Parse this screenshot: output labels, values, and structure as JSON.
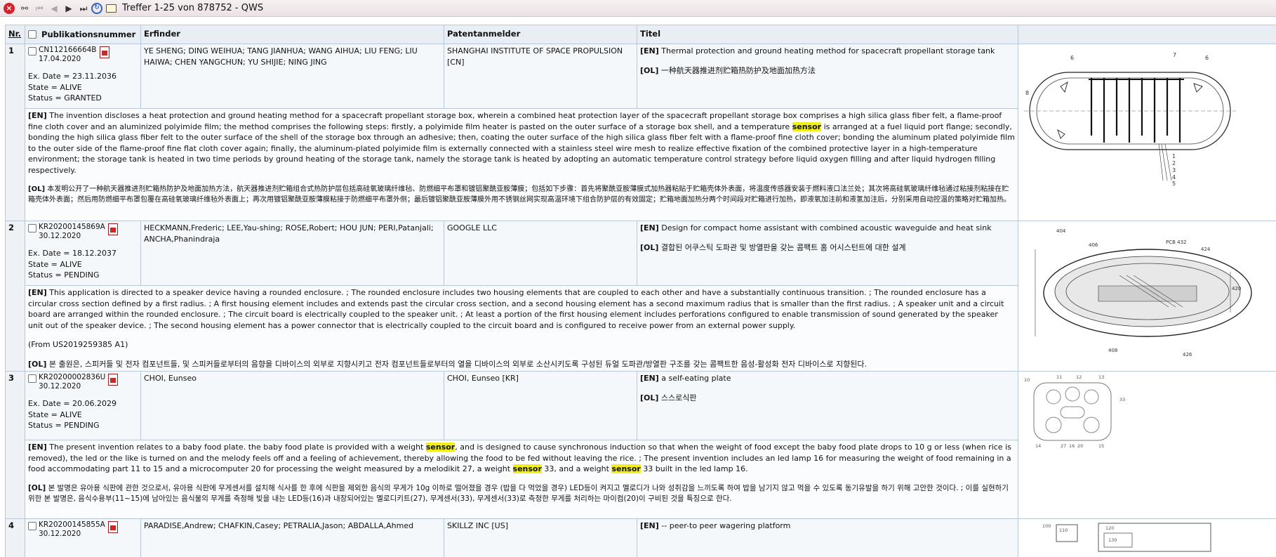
{
  "window": {
    "title": "Treffer 1-25 von 878752 - QWS"
  },
  "columns": {
    "nr": "Nr.",
    "publication": "Publikationsnummer",
    "inventor": "Erfinder",
    "applicant": "Patentanmelder",
    "title": "Titel"
  },
  "rows": [
    {
      "nr": "1",
      "pub_number": "CN112166664B",
      "pub_date": "17.04.2020",
      "ex_date": "Ex. Date = 23.11.2036",
      "state": "State = ALIVE",
      "status": "Status = GRANTED",
      "inventors": "YE SHENG; DING WEIHUA; TANG JIANHUA; WANG AIHUA; LIU FENG; LIU HAIWA; CHEN YANGCHUN; YU SHIJIE; NING JING",
      "applicant": "SHANGHAI INSTITUTE OF SPACE PROPULSION [CN]",
      "title_en_tag": "[EN]",
      "title_en": "Thermal protection and ground heating method for spacecraft propellant storage tank",
      "title_ol_tag": "[OL]",
      "title_ol": "一种航天器推进剂贮箱热防护及地面加热方法",
      "abstract_en_tag": "[EN]",
      "abstract_en_a": "The invention discloses a heat protection and ground heating method for a spacecraft propellant storage box, wherein a combined heat protection layer of the spacecraft propellant storage box comprises a high silica glass fiber felt, a flame-proof fine cloth cover and an aluminized polyimide film; the method comprises the following steps: firstly, a polyimide film heater is pasted on the outer surface of a storage box shell, and a temperature",
      "abstract_en_hl1": "sensor",
      "abstract_en_b": "is arranged at a fuel liquid port flange; secondly, bonding the high silica glass fiber felt to the outer surface of the shell of the storage box through an adhesive; then, coating the outer surface of the high silica glass fiber felt with a flame-proof fine cloth cover; bonding the aluminum plated polyimide film to the outer side of the flame-proof fine flat cloth cover again; finally, the aluminum-plated polyimide film is externally connected with a stainless steel wire mesh to realize effective fixation of the combined protective layer in a high-temperature environment; the storage tank is heated in two time periods by ground heating of the storage tank, namely the storage tank is heated by adopting an automatic temperature control strategy before liquid oxygen filling and after liquid hydrogen filling respectively.",
      "abstract_ol_tag": "[OL]",
      "abstract_ol": "本发明公开了一种航天器推进剂贮箱热防护及地面加热方法，航天器推进剂贮箱组合式热防护层包括高硅氧玻璃纤维毡、防燃细平布罩和镀铝聚酰亚胺薄膜；包括如下步骤：首先将聚酰亚胺薄膜式加热器粘贴于贮箱壳体外表面，将温度传感器安装于燃料液口法兰处；其次将高硅氧玻璃纤维毡通过粘接剂粘接在贮箱壳体外表面；然后用防燃细平布罩包覆在高硅氧玻璃纤维毡外表面上；再次用镀铝聚酰亚胺薄膜粘接于防燃细平布罩外侧；最后镀铝聚酰亚胺薄膜外用不锈钢丝网实现高温环境下组合防护层的有效固定；贮箱地面加热分两个时间段对贮箱进行加热，即液氧加注前和液氢加注后，分别采用自动控温的策略对贮箱加热。"
    },
    {
      "nr": "2",
      "pub_number": "KR20200145869A",
      "pub_date": "30.12.2020",
      "ex_date": "Ex. Date = 18.12.2037",
      "state": "State = ALIVE",
      "status": "Status = PENDING",
      "inventors": "HECKMANN,Frederic; LEE,Yau-shing; ROSE,Robert; HOU JUN; PERI,Patanjali; ANCHA,Phanindraja",
      "applicant": "GOOGLE LLC",
      "title_en_tag": "[EN]",
      "title_en": "Design for compact home assistant with combined acoustic waveguide and heat sink",
      "title_ol_tag": "[OL]",
      "title_ol": "결합된 어쿠스틱 도파관 및 방열판을 갖는 콤팩트 홈 어시스턴트에 대한 설계",
      "abstract_en_tag": "[EN]",
      "abstract_en": "This application is directed to a speaker device having a rounded enclosure. ; The rounded enclosure includes two housing elements that are coupled to each other and have a substantially continuous transition. ; The rounded enclosure has a circular cross section defined by a first radius. ; A first housing element includes and extends past the circular cross section, and a second housing element has a second maximum radius that is smaller than the first radius. ; A speaker unit and a circuit board are arranged within the rounded enclosure. ; The circuit board is electrically coupled to the speaker unit. ; At least a portion of the first housing element includes perforations configured to enable transmission of sound generated by the speaker unit out of the speaker device. ; The second housing element has a power connector that is electrically coupled to the circuit board and is configured to receive power from an external power supply.",
      "abstract_from": "(From US2019259385 A1)",
      "abstract_ol_tag": "[OL]",
      "abstract_ol": "본 출원은, 스피커들 및 전자 컴포넌트들, 및 스피커들로부터의 음향을 디바이스의 외부로 지향시키고 전자 컴포넌트들로부터의 열을 디바이스의 외부로 소산시키도록 구성된 듀얼 도파관/방열판 구조를 갖는 콤팩트한 음성-활성화 전자 디바이스로 지향된다."
    },
    {
      "nr": "3",
      "pub_number": "KR20200002836U",
      "pub_date": "30.12.2020",
      "ex_date": "Ex. Date = 20.06.2029",
      "state": "State = ALIVE",
      "status": "Status = PENDING",
      "inventors": "CHOI, Eunseo",
      "applicant": "CHOI, Eunseo [KR]",
      "title_en_tag": "[EN]",
      "title_en": "a self-eating plate",
      "title_ol_tag": "[OL]",
      "title_ol": "스스로식판",
      "abstract_en_tag": "[EN]",
      "abstract_en_a": "The present invention relates to a baby food plate. the baby food plate is provided with a weight",
      "abstract_en_hl1": "sensor",
      "abstract_en_b": ", and is designed to cause synchronous induction so that when the weight of food except the baby food plate drops to 10 g or less (when rice is removed), the led or the like is turned on and the melody feels off and a feeling of achievement, thereby allowing the food to be fed without leaving the rice. ; The present invention includes an led lamp 16 for measuring the weight of food remaining in a food accommodating part 11 to 15 and a microcomputer 20 for processing the weight measured by a melodikit 27, a weight",
      "abstract_en_hl2": "sensor",
      "abstract_en_c": "33, and a weight",
      "abstract_en_hl3": "sensor",
      "abstract_en_d": "33 built in the led lamp 16.",
      "abstract_ol_tag": "[OL]",
      "abstract_ol": "본 발명은 유아용 식판에 관한 것으로서, 유아용 식판에 무게센서를 설치해 식사를 한 후에 식판을 제외한 음식의 무게가 10g 이하로 떨어졌을 경우 (밥을 다 먹었을 경우) LED등이 켜지고 멜로디가 나와 성취감을 느끼도록 하여 밥을 남기지 않고 먹을 수 있도록 동기유발을 하기 위해 고안한 것이다. ; 이를 실현하기 위한 본 발명은, 음식수용부(11~15)에 남아있는 음식물의 무게를 측정해 빛을 내는 LED등(16)과 내장되어있는 멜로디키트(27), 무게센서(33), 무게센서(33)로 측정한 무게를 처리하는 마이컴(20)이 구비된 것을 특징으로 한다."
    },
    {
      "nr": "4",
      "pub_number": "KR20200145855A",
      "pub_date": "30.12.2020",
      "inventors": "PARADISE,Andrew; CHAFKIN,Casey; PETRALIA,Jason; ABDALLA,Ahmed",
      "applicant": "SKILLZ INC [US]",
      "title_en_tag": "[EN]",
      "title_en": "-- peer-to peer wagering platform"
    }
  ],
  "drawing_labels": {
    "r1": [
      "6",
      "7",
      "6",
      "8",
      "1",
      "2",
      "3",
      "4",
      "5"
    ],
    "r2": [
      "404",
      "406",
      "PCB 432",
      "424",
      "420",
      "408",
      "426"
    ],
    "r3": [
      "10",
      "11",
      "12",
      "13",
      "33",
      "14",
      "27",
      "16",
      "20",
      "15"
    ],
    "r4": [
      "100",
      "110",
      "120",
      "130"
    ]
  }
}
